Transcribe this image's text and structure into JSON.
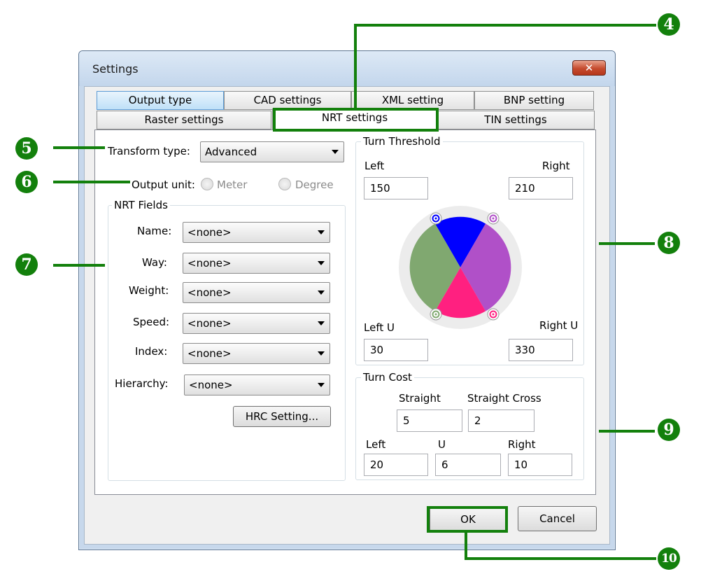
{
  "window": {
    "title": "Settings",
    "close_symbol": "✕"
  },
  "tabs": {
    "row1": [
      "Output type",
      "CAD settings",
      "XML setting",
      "BNP setting"
    ],
    "row2": [
      "Raster settings",
      "NRT settings",
      "TIN settings"
    ]
  },
  "transform": {
    "label": "Transform type:",
    "value": "Advanced"
  },
  "output_unit": {
    "label": "Output unit:",
    "meter": "Meter",
    "degree": "Degree"
  },
  "nrt_fields": {
    "title": "NRT Fields",
    "rows": [
      {
        "label": "Name:",
        "value": "<none>"
      },
      {
        "label": "Way:",
        "value": "<none>"
      },
      {
        "label": "Weight:",
        "value": "<none>"
      },
      {
        "label": "Speed:",
        "value": "<none>"
      },
      {
        "label": "Index:",
        "value": "<none>"
      },
      {
        "label": "Hierarchy:",
        "value": "<none>"
      }
    ],
    "hrc_button": "HRC Setting..."
  },
  "turn_threshold": {
    "title": "Turn Threshold",
    "left_label": "Left",
    "left_value": "150",
    "right_label": "Right",
    "right_value": "210",
    "left_u_label": "Left U",
    "left_u_value": "30",
    "right_u_label": "Right U",
    "right_u_value": "330",
    "colors": {
      "straight": "#0000ff",
      "right": "#b050c8",
      "u_turn": "#ff2080",
      "left": "#80a870"
    }
  },
  "turn_cost": {
    "title": "Turn Cost",
    "straight_label": "Straight",
    "straight_value": "5",
    "straight_cross_label": "Straight Cross",
    "straight_cross_value": "2",
    "left_label": "Left",
    "left_value": "20",
    "u_label": "U",
    "u_value": "6",
    "right_label": "Right",
    "right_value": "10"
  },
  "buttons": {
    "ok": "OK",
    "cancel": "Cancel"
  },
  "callouts": {
    "c4": "4",
    "c5": "5",
    "c6": "6",
    "c7": "7",
    "c8": "8",
    "c9": "9",
    "c10": "10"
  },
  "annotation_color": "#13800c"
}
